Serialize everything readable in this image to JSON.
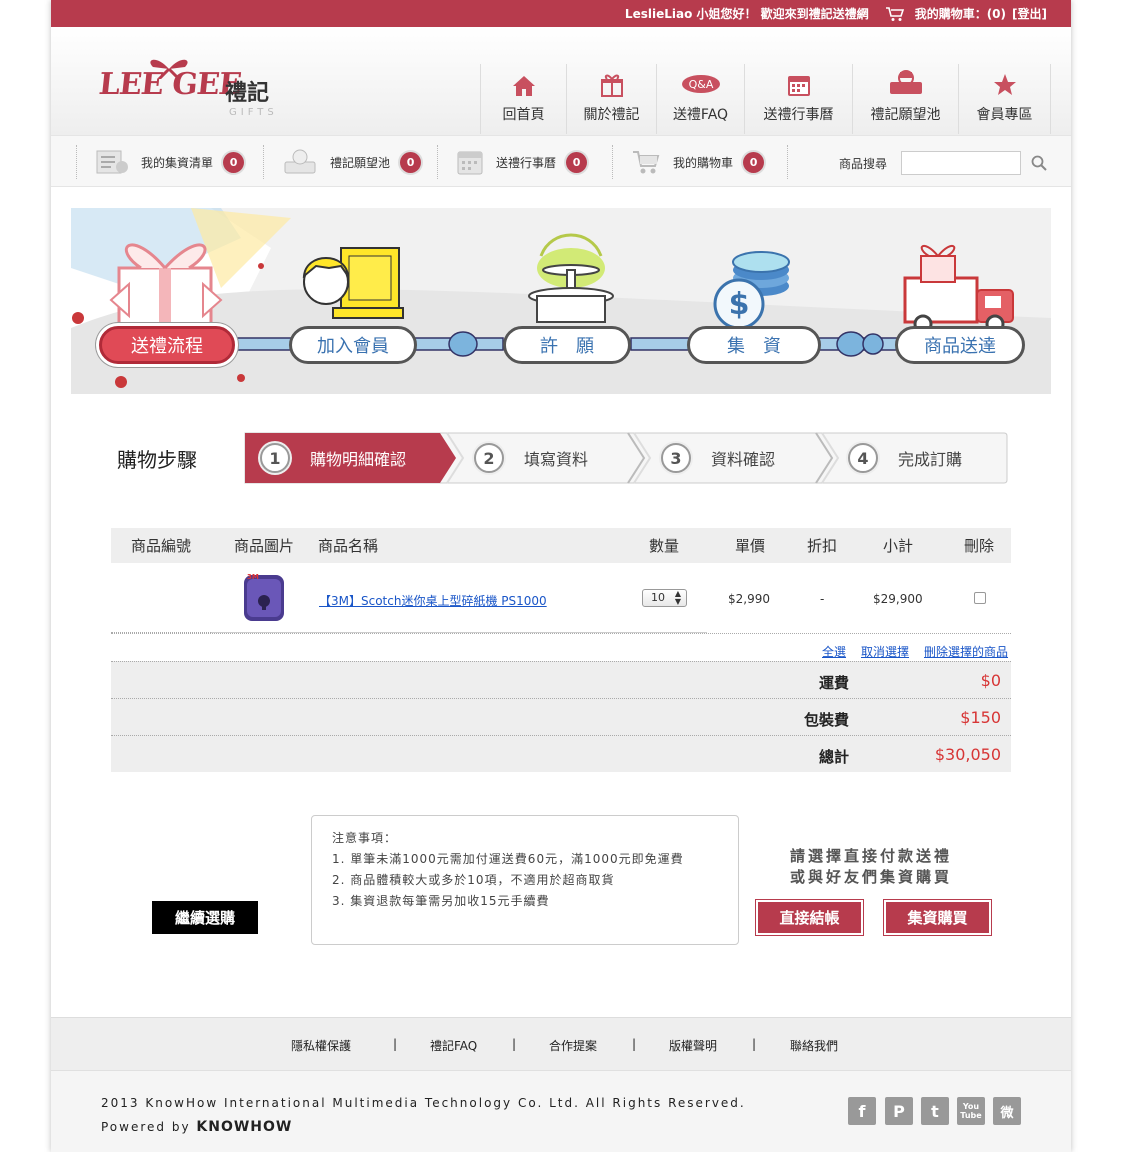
{
  "topbar": {
    "greeting": "LeslieLiao 小姐您好！ 歡迎來到禮記送禮網",
    "cart_label": "我的購物車：(0)",
    "logout": "[登出]"
  },
  "logo": {
    "text": "LEE GEE",
    "cn": "禮記",
    "gifts": "GIFTS"
  },
  "nav": [
    {
      "label": "回首頁",
      "icon": "home-icon"
    },
    {
      "label": "關於禮記",
      "icon": "gift-icon"
    },
    {
      "label": "送禮FAQ",
      "icon": "qa-icon",
      "badge": "Q&A"
    },
    {
      "label": "送禮行事曆",
      "icon": "calendar-icon"
    },
    {
      "label": "禮記願望池",
      "icon": "wishpool-icon"
    },
    {
      "label": "會員專區",
      "icon": "star-icon"
    }
  ],
  "toolbar": [
    {
      "label": "我的集資清單",
      "count": "0",
      "icon": "fundraise-list-icon"
    },
    {
      "label": "禮記願望池",
      "count": "0",
      "icon": "wish-icon"
    },
    {
      "label": "送禮行事曆",
      "count": "0",
      "icon": "calendar-icon"
    },
    {
      "label": "我的購物車",
      "count": "0",
      "icon": "cart-icon"
    }
  ],
  "search": {
    "label": "商品搜尋",
    "placeholder": ""
  },
  "banner": {
    "steps": [
      "送禮流程",
      "加入會員",
      "許　願",
      "集　資",
      "商品送達"
    ]
  },
  "purchase_steps": {
    "title": "購物步驟",
    "steps": [
      {
        "num": "1",
        "label": "購物明細確認"
      },
      {
        "num": "2",
        "label": "填寫資料"
      },
      {
        "num": "3",
        "label": "資料確認"
      },
      {
        "num": "4",
        "label": "完成訂購"
      }
    ]
  },
  "cart": {
    "headers": {
      "id": "商品編號",
      "image": "商品圖片",
      "name": "商品名稱",
      "qty": "數量",
      "price": "單價",
      "discount": "折扣",
      "subtotal": "小計",
      "delete": "刪除"
    },
    "items": [
      {
        "id": "",
        "name": "【3M】Scotch迷你桌上型碎紙機 PS1000",
        "qty": "10",
        "price": "$2,990",
        "discount": "-",
        "subtotal": "$29,900",
        "brand": "3M"
      }
    ],
    "actions": {
      "select_all": "全選",
      "deselect": "取消選擇",
      "delete_selected": "刪除選擇的商品"
    },
    "summary": [
      {
        "label": "運費",
        "value": "$0"
      },
      {
        "label": "包裝費",
        "value": "$150"
      },
      {
        "label": "總計",
        "value": "$30,050"
      }
    ]
  },
  "continue_button": "繼續選購",
  "notice": {
    "title": "注意事項：",
    "items": [
      "1. 單筆未滿1000元需加付運送費60元，滿1000元即免運費",
      "2. 商品體積較大或多於10項，不適用於超商取貨",
      "3. 集資退款每筆需另加收15元手續費"
    ]
  },
  "payment": {
    "prompt_line1": "請選擇直接付款送禮",
    "prompt_line2": "或與好友們集資購買",
    "direct": "直接結帳",
    "group": "集資購買"
  },
  "footer": {
    "links": [
      "隱私權保護",
      "禮記FAQ",
      "合作提案",
      "版權聲明",
      "聯絡我們"
    ],
    "separator": "|",
    "copyright": "2013 KnowHow International Multimedia Technology Co. Ltd. All Rights Reserved.",
    "powered_by": "Powered by",
    "brand": "KNOWHOW"
  },
  "social": [
    {
      "icon": "facebook-icon",
      "glyph": "f"
    },
    {
      "icon": "plurk-icon",
      "glyph": "P"
    },
    {
      "icon": "twitter-icon",
      "glyph": "t"
    },
    {
      "icon": "youtube-icon",
      "glyph": "You Tube"
    },
    {
      "icon": "weibo-icon",
      "glyph": "微"
    }
  ],
  "colors": {
    "brand": "#b73b4d",
    "price": "#d73535",
    "link": "#1a56c8"
  }
}
